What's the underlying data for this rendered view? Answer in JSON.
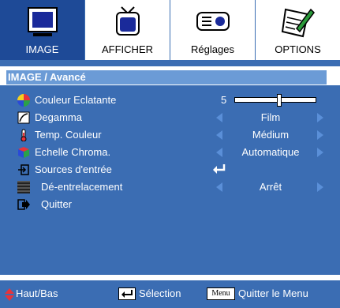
{
  "tabs": [
    {
      "label": "IMAGE",
      "icon": "monitor-icon"
    },
    {
      "label": "AFFICHER",
      "icon": "tv-icon"
    },
    {
      "label": "Réglages",
      "icon": "projector-icon"
    },
    {
      "label": "OPTIONS",
      "icon": "notepad-pencil-icon"
    }
  ],
  "breadcrumb": "IMAGE / Avancé",
  "menu": [
    {
      "label": "Couleur Eclatante",
      "icon": "color-wheel-icon",
      "value": "5",
      "slider_fraction": 0.55
    },
    {
      "label": "Degamma",
      "icon": "gamma-curve-icon",
      "value": "Film"
    },
    {
      "label": "Temp. Couleur",
      "icon": "thermometer-icon",
      "value": "Médium"
    },
    {
      "label": "Echelle Chroma.",
      "icon": "color-cube-icon",
      "value": "Automatique"
    },
    {
      "label": "Sources d'entrée",
      "icon": "input-source-icon"
    },
    {
      "label": "Dé-entrelacement",
      "icon": "deinterlace-icon",
      "value": "Arrêt"
    },
    {
      "label": "Quitter",
      "icon": "exit-icon"
    }
  ],
  "footer": {
    "nav": "Haut/Bas",
    "select": "Sélection",
    "menu_key": "Menu",
    "quit": "Quitter le Menu"
  },
  "colors": {
    "panel": "#3b6db3",
    "active_tab": "#1e4a97",
    "breadcrumb": "#6b9bd6",
    "arrow": "#5a8fd8",
    "footer_arrow": "#e8333a"
  }
}
